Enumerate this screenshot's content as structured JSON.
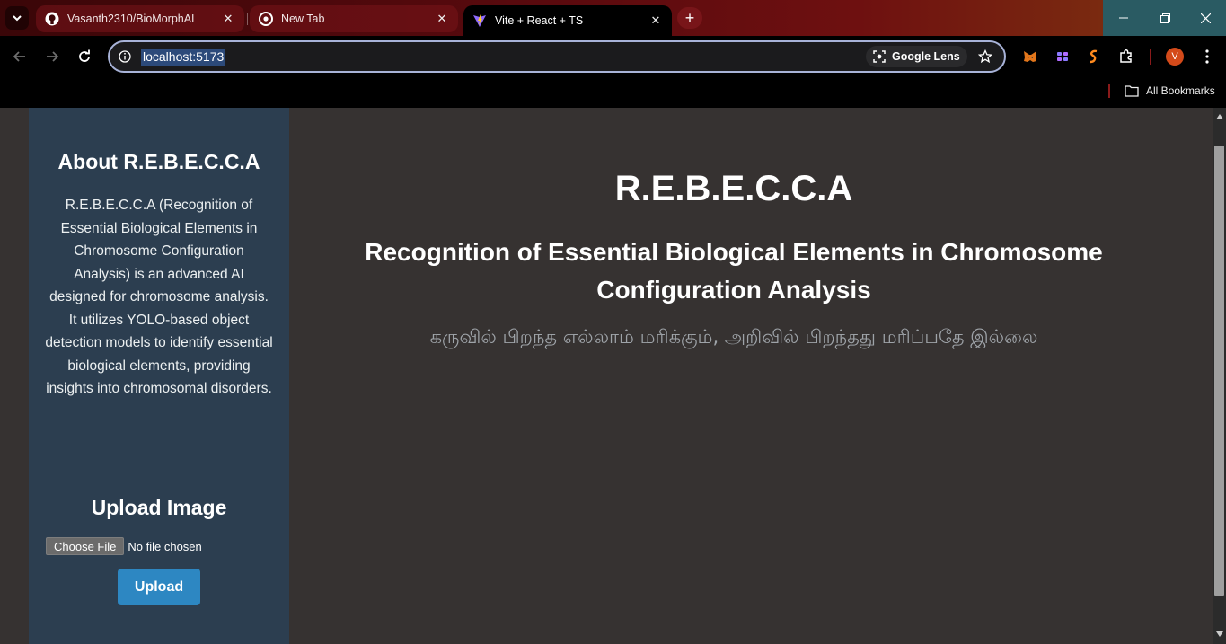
{
  "browser": {
    "tabs": [
      {
        "title": "Vasanth2310/BioMorphAI",
        "favicon": "github-icon",
        "active": false
      },
      {
        "title": "New Tab",
        "favicon": "chrome-icon",
        "active": false
      },
      {
        "title": "Vite + React + TS",
        "favicon": "vite-icon",
        "active": true
      }
    ],
    "new_tab_label": "+",
    "address": "localhost:5173",
    "lens_label": "Google Lens",
    "profile_initial": "V",
    "all_bookmarks_label": "All Bookmarks",
    "extensions": [
      "metamask-icon",
      "extension-purple-icon",
      "extension-orange-icon",
      "puzzle-icon"
    ]
  },
  "sidebar": {
    "about_title": "About R.E.B.E.C.C.A",
    "about_text": "R.E.B.E.C.C.A (Recognition of Essential Biological Elements in Chromosome Configuration Analysis) is an advanced AI designed for chromosome analysis. It utilizes YOLO-based object detection models to identify essential biological elements, providing insights into chromosomal disorders.",
    "upload_title": "Upload Image",
    "choose_file_label": "Choose File",
    "no_file_label": "No file chosen",
    "upload_button_label": "Upload"
  },
  "main": {
    "title": "R.E.B.E.C.C.A",
    "subtitle": "Recognition of Essential Biological Elements in Chromosome Configuration Analysis",
    "tagline": "கருவில் பிறந்த எல்லாம் மரிக்கும், அறிவில் பிறந்தது மரிப்பதே இல்லை"
  },
  "colors": {
    "sidebar_bg": "#2c3e50",
    "page_bg": "#363231",
    "upload_button": "#2d87c2",
    "tagline": "#9ea3a8"
  }
}
